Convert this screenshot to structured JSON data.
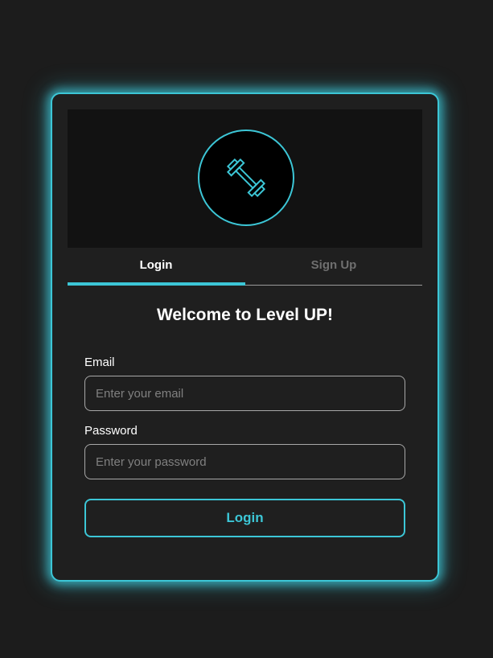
{
  "logo": {
    "icon": "dumbbell-icon",
    "accent_color": "#3cc6d6"
  },
  "tabs": [
    {
      "label": "Login",
      "active": true
    },
    {
      "label": "Sign Up",
      "active": false
    }
  ],
  "form": {
    "title": "Welcome to Level UP!",
    "email": {
      "label": "Email",
      "placeholder": "Enter your email",
      "value": ""
    },
    "password": {
      "label": "Password",
      "placeholder": "Enter your password",
      "value": ""
    },
    "submit_label": "Login"
  }
}
